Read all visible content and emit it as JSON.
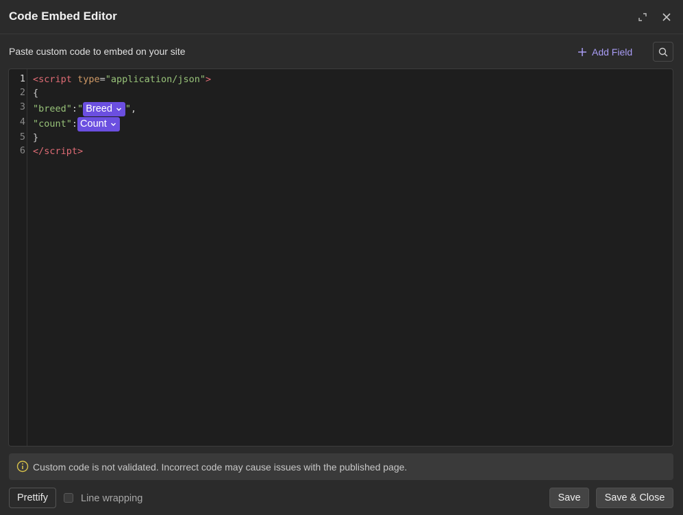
{
  "header": {
    "title": "Code Embed Editor",
    "expand_icon": "expand-icon",
    "close_icon": "close-icon"
  },
  "toolbar": {
    "subtitle": "Paste custom code to embed on your site",
    "add_field_label": "Add Field",
    "add_field_icon": "plus-icon",
    "search_icon": "search-icon"
  },
  "editor": {
    "line_numbers": [
      "1",
      "2",
      "3",
      "4",
      "5",
      "6"
    ],
    "active_line": 1,
    "line1": {
      "open": "<",
      "tag": "script",
      "attr": "type",
      "eq": "=",
      "value": "\"application/json\"",
      "close": ">"
    },
    "line2": {
      "text": "{"
    },
    "line3": {
      "key": "\"breed\"",
      "colon": ":",
      "quote_open": "\"",
      "chip": "Breed",
      "quote_close": "\"",
      "comma": ","
    },
    "line4": {
      "key": "\"count\"",
      "colon": ":",
      "chip": "Count"
    },
    "line5": {
      "text": "}"
    },
    "line6": {
      "open": "</",
      "tag": "script",
      "close": ">"
    },
    "colors": {
      "tag": "#e06c75",
      "attr": "#d19a66",
      "string": "#98c379",
      "chip_bg": "#6b4fe0"
    }
  },
  "notice": {
    "icon": "info-icon",
    "text": "Custom code is not validated. Incorrect code may cause issues with the published page."
  },
  "footer": {
    "prettify_label": "Prettify",
    "line_wrapping_label": "Line wrapping",
    "line_wrapping_checked": false,
    "save_label": "Save",
    "save_close_label": "Save & Close"
  }
}
